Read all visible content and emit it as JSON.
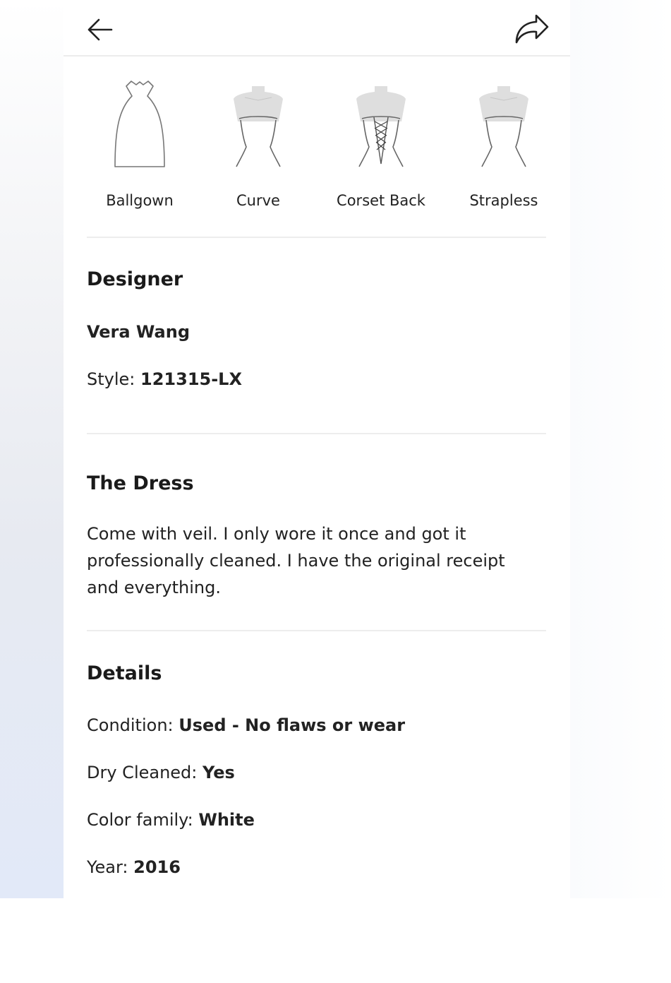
{
  "header": {
    "back_icon": "arrow-left-icon",
    "share_icon": "share-arrow-icon"
  },
  "silhouettes": [
    {
      "label": "Ballgown",
      "icon": "ballgown-silhouette-icon"
    },
    {
      "label": "Curve",
      "icon": "curve-silhouette-icon"
    },
    {
      "label": "Corset Back",
      "icon": "corset-back-silhouette-icon"
    },
    {
      "label": "Strapless",
      "icon": "strapless-silhouette-icon"
    }
  ],
  "designer": {
    "title": "Designer",
    "name": "Vera Wang",
    "style_label": "Style:",
    "style_value": "121315-LX"
  },
  "dress": {
    "title": "The Dress",
    "description": "Come with veil. I only wore it once and got it professionally cleaned. I have the original receipt and everything."
  },
  "details": {
    "title": "Details",
    "condition_label": "Condition:",
    "condition_value": "Used - No flaws or wear",
    "dry_cleaned_label": "Dry Cleaned:",
    "dry_cleaned_value": "Yes",
    "color_label": "Color family:",
    "color_value": "White",
    "year_label": "Year:",
    "year_value": "2016"
  }
}
